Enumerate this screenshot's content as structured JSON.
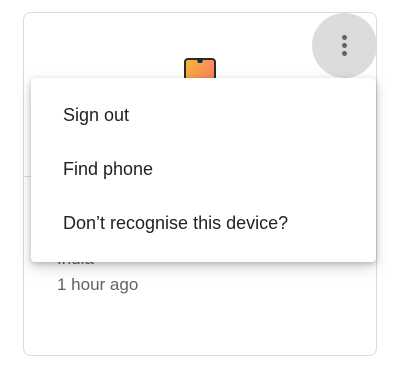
{
  "device_card": {
    "location": "India",
    "last_seen": "1 hour ago",
    "icon": "phone-icon"
  },
  "more_button": {
    "icon": "more-vert-icon"
  },
  "menu": {
    "items": [
      {
        "label": "Sign out"
      },
      {
        "label": "Find phone"
      },
      {
        "label": "Don’t recognise this device?"
      }
    ]
  },
  "colors": {
    "border": "#dadce0",
    "text_primary": "#202124",
    "text_secondary": "#5f6368",
    "button_hover": "#dcdcdc"
  }
}
